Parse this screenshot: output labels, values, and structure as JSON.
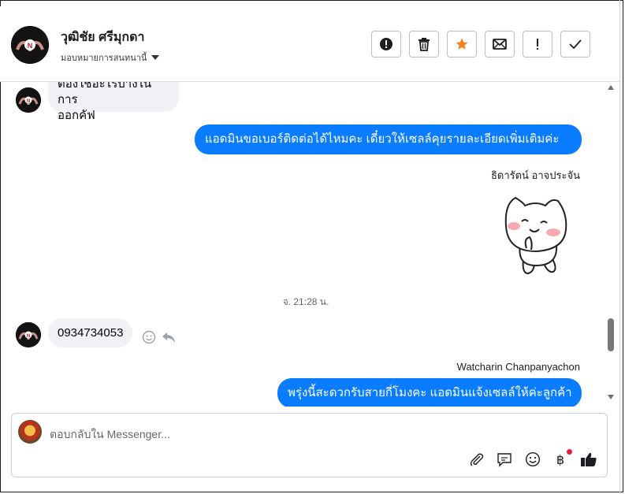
{
  "header": {
    "contact_name": "วุฒิชัย ศรีมุกดา",
    "assign_label": "มอบหมายการสนทนานี้",
    "toolbar": [
      {
        "name": "spam-button",
        "icon": "exclamation-circle-icon"
      },
      {
        "name": "delete-button",
        "icon": "trash-icon"
      },
      {
        "name": "star-button",
        "icon": "star-icon"
      },
      {
        "name": "mark-unread-button",
        "icon": "envelope-icon"
      },
      {
        "name": "follow-up-button",
        "icon": "exclamation-icon"
      },
      {
        "name": "done-button",
        "icon": "check-icon"
      }
    ]
  },
  "colors": {
    "accent": "#0a7cff",
    "star": "#f5821f",
    "bubble_in": "#f0f2f5"
  },
  "messages": {
    "in_1_line1": "ต้องใช้อะไรบ้างในการ",
    "in_1_line2": "ออกคัฟ",
    "out_1": "แอดมินขอเบอร์ติดต่อได้ไหมคะ เดี๋ยวให้เซลล์คุยรายละเอียดเพิ่มเติมค่ะ",
    "sender_1": "ธิดารัตน์ อาจประจัน",
    "sticker": "cat-sticker",
    "timestamp": "จ. 21:28 น.",
    "in_2": "0934734053",
    "sender_2": "Watcharin Chanpanyachon",
    "out_2": "พรุ่งนี้สะดวกรับสายกี่โมงคะ แอดมินแจ้งเซลล์ให้ค่ะลูกค้า"
  },
  "composer": {
    "placeholder": "ตอบกลับใน Messenger...",
    "icons": [
      "attach-icon",
      "saved-reply-icon",
      "emoji-icon",
      "payment-icon",
      "like-icon"
    ]
  }
}
